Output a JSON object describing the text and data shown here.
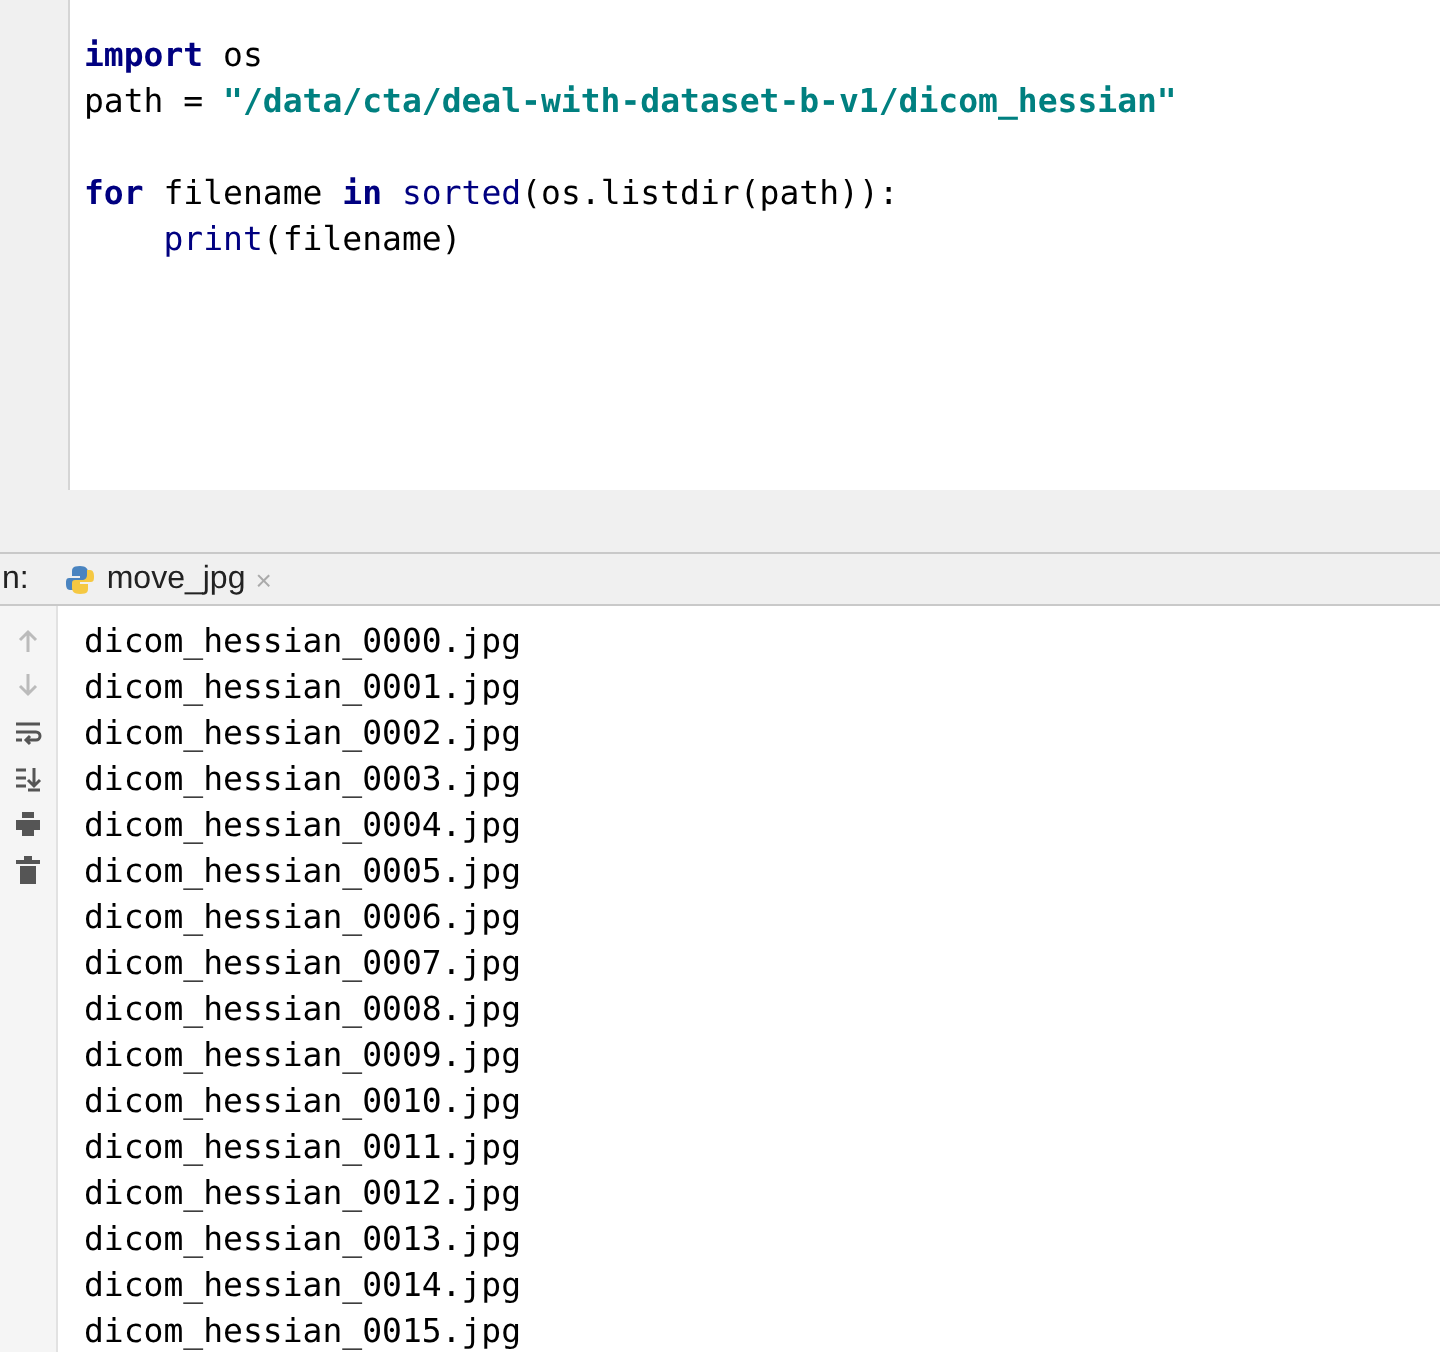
{
  "editor": {
    "lines": [
      {
        "gap_before": false,
        "indented": false,
        "tokens": [
          {
            "text": "import",
            "kind": "keyword"
          },
          {
            "text": " os",
            "kind": "plain"
          }
        ]
      },
      {
        "gap_before": false,
        "indented": false,
        "tokens": [
          {
            "text": "path = ",
            "kind": "plain"
          },
          {
            "text": "\"/data/cta/deal-with-dataset-b-v1/dicom_hessian\"",
            "kind": "string"
          }
        ]
      },
      {
        "gap_before": true,
        "indented": false,
        "tokens": [
          {
            "text": "for",
            "kind": "keyword"
          },
          {
            "text": " filename ",
            "kind": "plain"
          },
          {
            "text": "in ",
            "kind": "keyword"
          },
          {
            "text": "sorted",
            "kind": "builtin"
          },
          {
            "text": "(os.listdir(path)):",
            "kind": "plain"
          }
        ]
      },
      {
        "gap_before": false,
        "indented": true,
        "tokens": [
          {
            "text": "print",
            "kind": "builtin"
          },
          {
            "text": "(filename)",
            "kind": "plain"
          }
        ]
      }
    ]
  },
  "run_panel": {
    "label": "n:",
    "tab": {
      "title": "move_jpg",
      "close": "×",
      "selected": true
    },
    "toolbar": [
      {
        "kind": "up",
        "disabled": true
      },
      {
        "kind": "down",
        "disabled": true
      },
      {
        "kind": "wrap",
        "disabled": false
      },
      {
        "kind": "scroll-end",
        "disabled": false
      },
      {
        "kind": "print",
        "disabled": false
      },
      {
        "kind": "trash",
        "disabled": false
      }
    ],
    "output": [
      "dicom_hessian_0000.jpg",
      "dicom_hessian_0001.jpg",
      "dicom_hessian_0002.jpg",
      "dicom_hessian_0003.jpg",
      "dicom_hessian_0004.jpg",
      "dicom_hessian_0005.jpg",
      "dicom_hessian_0006.jpg",
      "dicom_hessian_0007.jpg",
      "dicom_hessian_0008.jpg",
      "dicom_hessian_0009.jpg",
      "dicom_hessian_0010.jpg",
      "dicom_hessian_0011.jpg",
      "dicom_hessian_0012.jpg",
      "dicom_hessian_0013.jpg",
      "dicom_hessian_0014.jpg",
      "dicom_hessian_0015.jpg"
    ]
  }
}
